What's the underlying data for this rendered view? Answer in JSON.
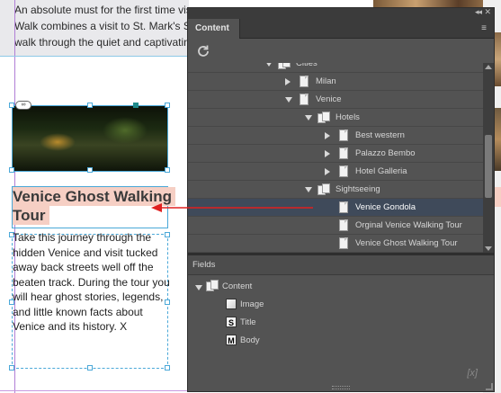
{
  "document": {
    "intro_lines": [
      "An absolute must for the first time vis",
      "Walk combines a visit to St. Mark's S",
      "walk through the quiet and captivatin"
    ],
    "heading_lines": [
      "Venice Ghost Walking",
      "Tour"
    ],
    "body_lines": [
      "Take this journey through the",
      "hidden Venice and visit tucked",
      "away back streets well off the",
      "beaten track. During the tour you",
      "will hear ghost stories, legends,",
      "and little known facts about",
      "Venice and its history. X"
    ],
    "link_badge": "∞"
  },
  "panel": {
    "tab_label": "Content",
    "collapse_glyph": "◂◂",
    "close_glyph": "✕",
    "menu_glyph": "≡",
    "tree": [
      {
        "label": "Cities",
        "icon": "stack",
        "expand": "down",
        "indent": 0
      },
      {
        "label": "Milan",
        "icon": "doc",
        "expand": "right",
        "indent": 1
      },
      {
        "label": "Venice",
        "icon": "doc",
        "expand": "down",
        "indent": 1
      },
      {
        "label": "Hotels",
        "icon": "stack",
        "expand": "down",
        "indent": 2
      },
      {
        "label": "Best western",
        "icon": "doc",
        "expand": "right",
        "indent": 3
      },
      {
        "label": "Palazzo Bembo",
        "icon": "doc",
        "expand": "right",
        "indent": 3
      },
      {
        "label": "Hotel Galleria",
        "icon": "doc",
        "expand": "right",
        "indent": 3
      },
      {
        "label": "Sightseeing",
        "icon": "stack",
        "expand": "down",
        "indent": 2
      },
      {
        "label": "Venice Gondola",
        "icon": "doc",
        "expand": "none",
        "indent": 3,
        "selected": true
      },
      {
        "label": "Orginal Venice Walking Tour",
        "icon": "doc",
        "expand": "none",
        "indent": 3
      },
      {
        "label": "Venice Ghost Walking Tour",
        "icon": "doc",
        "expand": "none",
        "indent": 3
      }
    ],
    "fields_title": "Fields",
    "fields": [
      {
        "label": "Content",
        "icon": "stack",
        "expand": "down"
      },
      {
        "label": "Image",
        "icon": "image-field"
      },
      {
        "label": "Title",
        "icon": "S"
      },
      {
        "label": "Body",
        "icon": "M"
      }
    ],
    "variable_icon_text": "[x]"
  },
  "colors": {
    "panel_bg": "#535353",
    "selection": "#3f4a5a",
    "arrow": "#e02020",
    "heading_highlight": "#f6cfc4"
  }
}
